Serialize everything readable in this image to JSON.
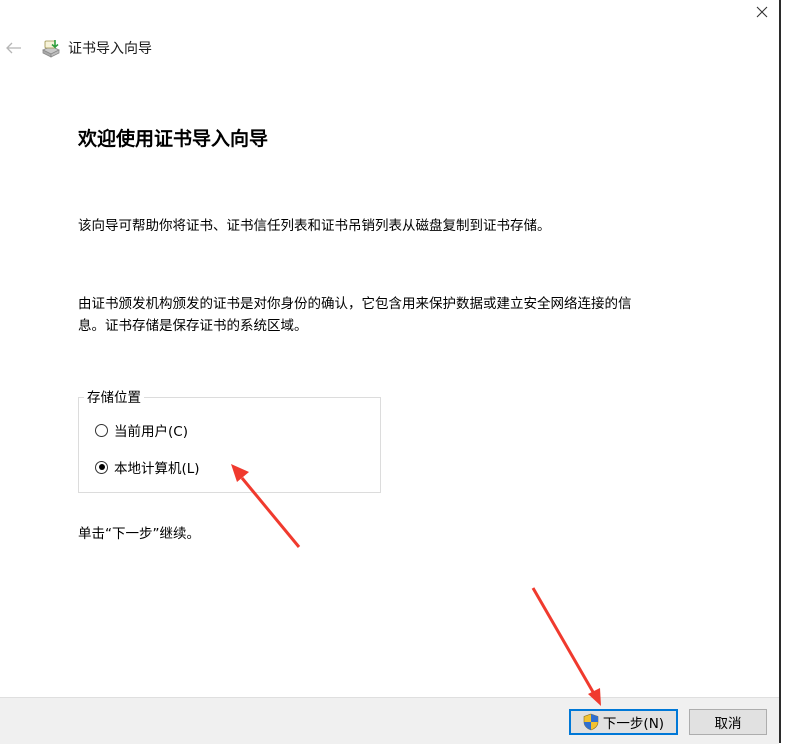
{
  "window": {
    "title": "证书导入向导"
  },
  "icons": {
    "back": "back-arrow-icon",
    "close": "close-icon",
    "app": "certificate-icon",
    "shield": "uac-shield-icon"
  },
  "content": {
    "heading": "欢迎使用证书导入向导",
    "paragraph1": "该向导可帮助你将证书、证书信任列表和证书吊销列表从磁盘复制到证书存储。",
    "paragraph2_line1": "由证书颁发机构颁发的证书是对你身份的确认，它包含用来保护数据或建立安全网络连接的信",
    "paragraph2_line2": "息。证书存储是保存证书的系统区域。",
    "store_location": {
      "legend": "存储位置",
      "options": [
        {
          "label": "当前用户(C)",
          "selected": false
        },
        {
          "label": "本地计算机(L)",
          "selected": true
        }
      ]
    },
    "continue_hint": "单击“下一步”继续。"
  },
  "buttons": {
    "next": "下一步(N)",
    "cancel": "取消"
  },
  "colors": {
    "annotation_arrow": "#f03a2e",
    "focus_border": "#0078d7",
    "footer_bg": "#f0f0f0"
  }
}
